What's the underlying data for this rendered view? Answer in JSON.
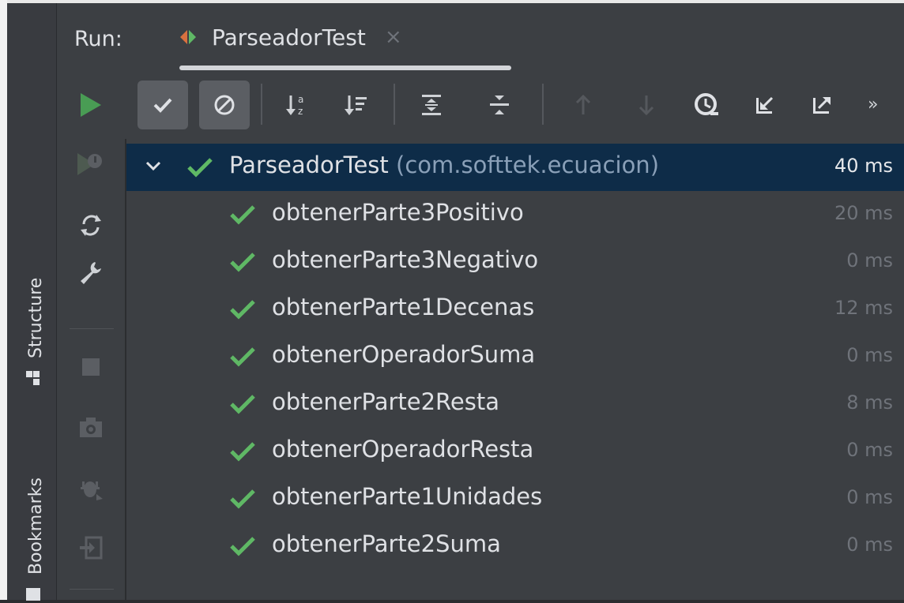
{
  "stripe": {
    "structure_label": "Structure",
    "bookmarks_label": "Bookmarks"
  },
  "run_panel": {
    "run_label": "Run:",
    "tab_title": "ParseadorTest",
    "tab_close": "×"
  },
  "toolbar": {
    "more_label": "»"
  },
  "results": {
    "suite": {
      "name": "ParseadorTest",
      "package": "(com.softtek.ecuacion)",
      "time": "40 ms"
    },
    "tests": [
      {
        "name": "obtenerParte3Positivo",
        "time": "20 ms"
      },
      {
        "name": "obtenerParte3Negativo",
        "time": "0 ms"
      },
      {
        "name": "obtenerParte1Decenas",
        "time": "12 ms"
      },
      {
        "name": "obtenerOperadorSuma",
        "time": "0 ms"
      },
      {
        "name": "obtenerParte2Resta",
        "time": "8 ms"
      },
      {
        "name": "obtenerOperadorResta",
        "time": "0 ms"
      },
      {
        "name": "obtenerParte1Unidades",
        "time": "0 ms"
      },
      {
        "name": "obtenerParte2Suma",
        "time": "0 ms"
      }
    ]
  },
  "colors": {
    "pass_green": "#5fb865",
    "run_green": "#499c54",
    "selection": "#0e2c48",
    "panel_bg": "#3c3f43"
  }
}
